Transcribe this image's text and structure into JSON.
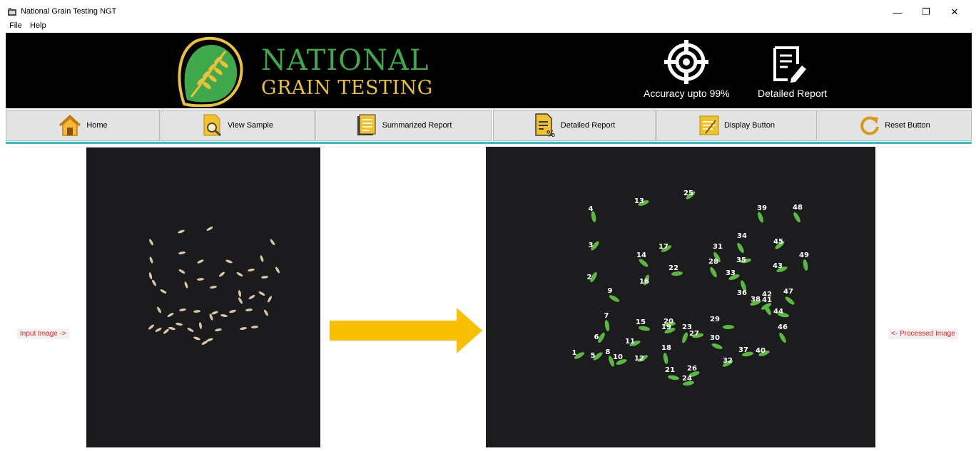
{
  "window": {
    "title": "National Grain Testing NGT",
    "minimize_glyph": "—",
    "restore_glyph": "❐",
    "close_glyph": "✕"
  },
  "menu": [
    {
      "label": "File"
    },
    {
      "label": "Help"
    }
  ],
  "banner": {
    "brand_line1": "NATIONAL",
    "brand_line2": "GRAIN TESTING",
    "features": [
      {
        "icon": "target-icon",
        "label": "Accuracy upto 99%"
      },
      {
        "icon": "report-edit-icon",
        "label": "Detailed Report"
      }
    ]
  },
  "toolbar": [
    {
      "icon": "home-icon",
      "label": "Home"
    },
    {
      "icon": "search-document-icon",
      "label": "View Sample"
    },
    {
      "icon": "notes-icon",
      "label": "Summarized Report"
    },
    {
      "icon": "percent-document-icon",
      "label": "Detailed Report"
    },
    {
      "icon": "display-icon",
      "label": "Display Button"
    },
    {
      "icon": "reset-icon",
      "label": "Reset Button"
    }
  ],
  "labels": {
    "input": "Input Image ->",
    "output": "<- Processed Image"
  },
  "colors": {
    "brand_green": "#3ea84a",
    "brand_gold": "#e9c23a",
    "accent_cyan": "#2fc0c8",
    "arrow": "#f9c002",
    "label_red": "#ff1d1d",
    "grain_green": "#59b93e"
  },
  "grain_numbers": [
    "1",
    "2",
    "3",
    "4",
    "5",
    "6",
    "7",
    "8",
    "9",
    "10",
    "11",
    "12",
    "13",
    "14",
    "15",
    "16",
    "17",
    "18",
    "19",
    "20",
    "21",
    "22",
    "23",
    "24",
    "25",
    "26",
    "27",
    "28",
    "29",
    "30",
    "31",
    "32",
    "33",
    "34",
    "35",
    "36",
    "37",
    "38",
    "39",
    "40",
    "41",
    "42",
    "43",
    "44",
    "45",
    "46",
    "47",
    "48",
    "49"
  ]
}
